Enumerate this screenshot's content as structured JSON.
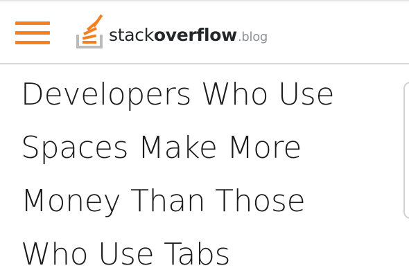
{
  "header": {
    "menu_icon": "hamburger-menu-icon",
    "logo": {
      "icon": "stack-overflow-logo-icon",
      "text_stack": "stack",
      "text_overflow": "overflow",
      "text_blog": ".blog"
    }
  },
  "article": {
    "title_lines": [
      "Developers Who Use",
      "Spaces Make More",
      "Money Than Those",
      "Who Use Tabs"
    ]
  },
  "colors": {
    "accent": "#f48024",
    "text": "#1b1b1b",
    "logo_gray": "#bcbbbb",
    "divider": "#d6d9dc"
  }
}
